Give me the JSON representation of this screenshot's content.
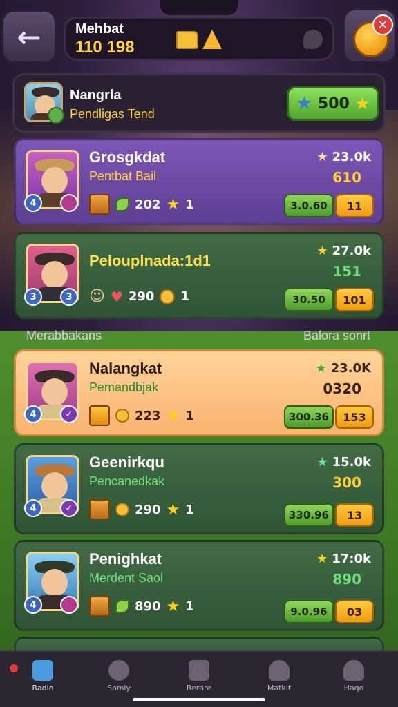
{
  "top_bar": {
    "title": "Mehbat",
    "score": "110 198"
  },
  "player": {
    "name": "Nangrla",
    "subtitle": "Pendligas Tend",
    "score": "500"
  },
  "cards_top": [
    {
      "title": "Grosgkdat",
      "subtitle": "Pentbat Bail",
      "right_top": "23.0k",
      "right_mid": "610",
      "right_mid_color": "#ffd23a",
      "stat1": "202",
      "stat2": "1",
      "green_btn": "3.0.60",
      "orange_btn": "11",
      "badge_left": "4",
      "badge_right": "",
      "variant": "purple"
    },
    {
      "title": "Pelouplnada:1d1",
      "subtitle": "",
      "right_top": "27.0k",
      "right_mid": "151",
      "right_mid_color": "#6fe07a",
      "stat1": "290",
      "stat2": "1",
      "green_btn": "30.50",
      "orange_btn": "101",
      "badge_left": "3",
      "badge_right": "3",
      "variant": "green"
    }
  ],
  "section": {
    "left_label": "Merabbakans",
    "right_label": "Balora sonrt"
  },
  "cards_bottom": [
    {
      "title": "Nalangkat",
      "subtitle": "Pemandbjak",
      "right_top": "23.0K",
      "right_mid": "0320",
      "right_mid_color": "#3a2010",
      "stat1": "223",
      "stat2": "1",
      "green_btn": "300.36",
      "orange_btn": "153",
      "badge_left": "4",
      "badge_right": "",
      "variant": "peach"
    },
    {
      "title": "Geenirkqu",
      "subtitle": "Pencanedkak",
      "right_top": "15.0k",
      "right_mid": "300",
      "right_mid_color": "#ffd23a",
      "stat1": "290",
      "stat2": "1",
      "green_btn": "330.96",
      "orange_btn": "13",
      "badge_left": "4",
      "badge_right": "",
      "variant": "green"
    },
    {
      "title": "Penighkat",
      "subtitle": "Merdent Saol",
      "right_top": "17:0k",
      "right_mid": "890",
      "right_mid_color": "#6fe07a",
      "stat1": "890",
      "stat2": "1",
      "green_btn": "9.0.96",
      "orange_btn": "03",
      "badge_left": "4",
      "badge_right": "",
      "variant": "green"
    }
  ],
  "nav": [
    {
      "label": "Radlo",
      "icon": "home-icon",
      "active": true
    },
    {
      "label": "Somly",
      "icon": "game-controller-icon",
      "active": false
    },
    {
      "label": "Rerare",
      "icon": "building-icon",
      "active": false
    },
    {
      "label": "Matkit",
      "icon": "person-icon",
      "active": false
    },
    {
      "label": "Haqo",
      "icon": "profile-icon",
      "active": false
    }
  ]
}
